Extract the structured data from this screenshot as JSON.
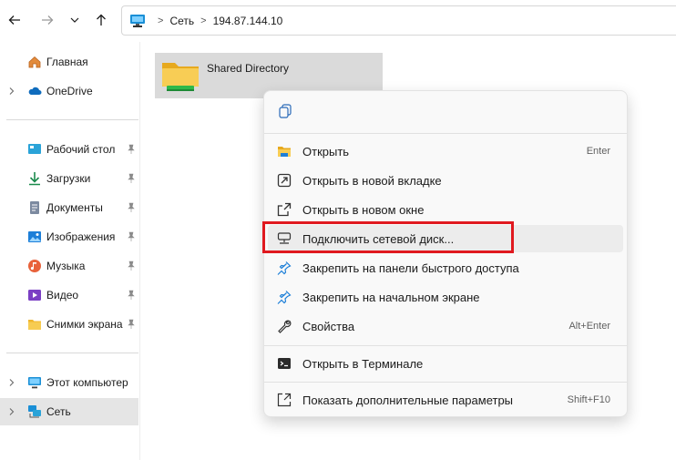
{
  "address_bar": {
    "breadcrumbs": [
      "Сеть",
      "194.87.144.10"
    ]
  },
  "sidebar": {
    "items": [
      {
        "label": "Главная",
        "icon": "home-icon"
      },
      {
        "label": "OneDrive",
        "icon": "onedrive-cloud-icon"
      },
      {
        "label": "Рабочий стол",
        "icon": "desktop-icon",
        "pinned": true
      },
      {
        "label": "Загрузки",
        "icon": "downloads-icon",
        "pinned": true
      },
      {
        "label": "Документы",
        "icon": "documents-icon",
        "pinned": true
      },
      {
        "label": "Изображения",
        "icon": "pictures-icon",
        "pinned": true
      },
      {
        "label": "Музыка",
        "icon": "music-icon",
        "pinned": true
      },
      {
        "label": "Видео",
        "icon": "videos-icon",
        "pinned": true
      },
      {
        "label": "Снимки экрана",
        "icon": "screenshots-folder-icon",
        "pinned": true
      },
      {
        "label": "Этот компьютер",
        "icon": "this-pc-icon"
      },
      {
        "label": "Сеть",
        "icon": "network-icon",
        "selected": true
      }
    ]
  },
  "content": {
    "items": [
      {
        "name": "Shared Directory",
        "icon": "network-share-folder-icon",
        "selected": true
      }
    ]
  },
  "context_menu": {
    "items": [
      {
        "label": "Открыть",
        "shortcut": "Enter",
        "icon": "open-folder-icon"
      },
      {
        "label": "Открыть в новой вкладке",
        "shortcut": "",
        "icon": "open-new-tab-icon"
      },
      {
        "label": "Открыть в новом окне",
        "shortcut": "",
        "icon": "open-new-window-icon"
      },
      {
        "label": "Подключить сетевой диск...",
        "shortcut": "",
        "icon": "map-network-drive-icon"
      },
      {
        "label": "Закрепить на панели быстрого доступа",
        "shortcut": "",
        "icon": "pin-quick-access-icon"
      },
      {
        "label": "Закрепить на начальном экране",
        "shortcut": "",
        "icon": "pin-start-icon"
      },
      {
        "label": "Свойства",
        "shortcut": "Alt+Enter",
        "icon": "properties-wrench-icon"
      },
      {
        "label": "Открыть в Терминале",
        "shortcut": "",
        "icon": "terminal-icon"
      },
      {
        "label": "Показать дополнительные параметры",
        "shortcut": "Shift+F10",
        "icon": "more-options-icon"
      }
    ],
    "highlighted_item": "Подключить сетевой диск..."
  },
  "colors": {
    "highlight_border": "#e0191f",
    "accent": "#0067c0"
  }
}
